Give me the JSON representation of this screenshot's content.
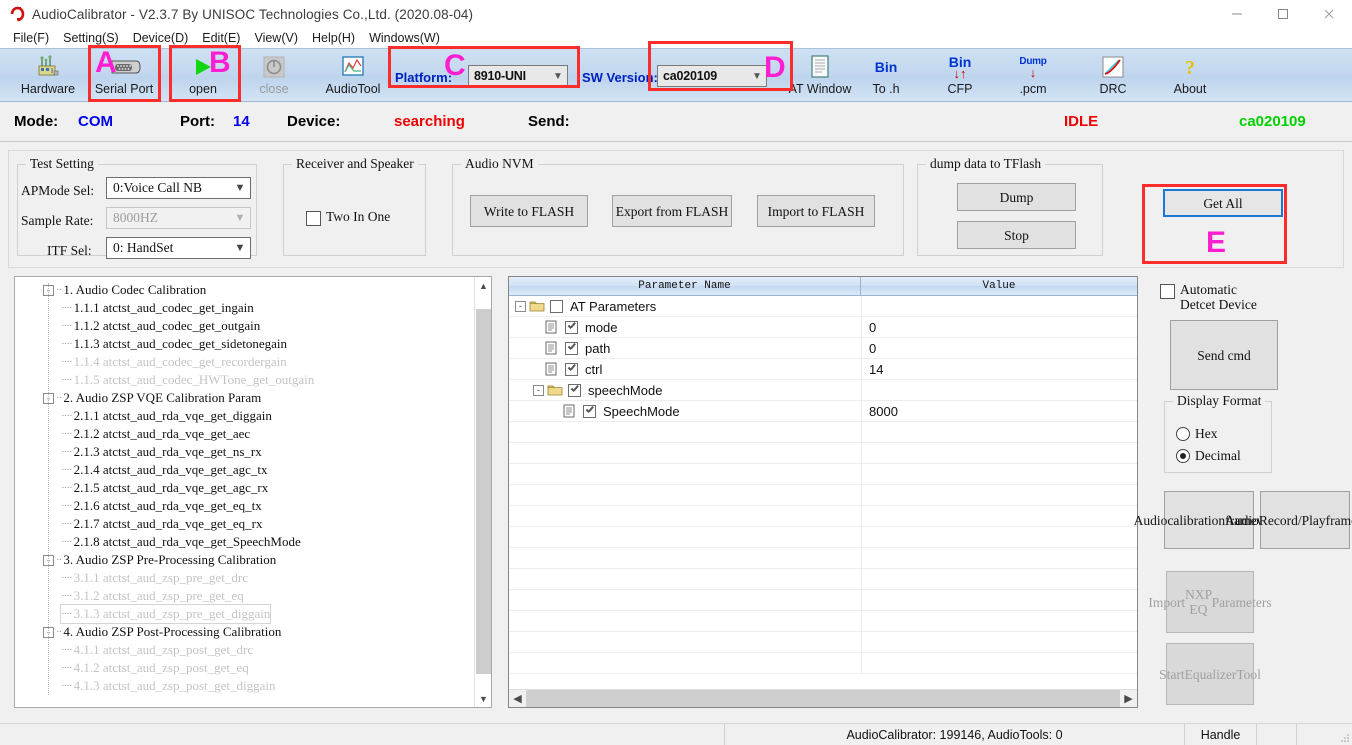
{
  "window": {
    "title": "AudioCalibrator - V2.3.7 By UNISOC Technologies Co.,Ltd. (2020.08-04)",
    "minimize_label": "—",
    "maximize_label": "□",
    "close_label": "✕"
  },
  "menu": [
    {
      "label": "File(F)"
    },
    {
      "label": "Setting(S)"
    },
    {
      "label": "Device(D)"
    },
    {
      "label": "Edit(E)"
    },
    {
      "label": "View(V)"
    },
    {
      "label": "Help(H)"
    },
    {
      "label": "Windows(W)"
    }
  ],
  "toolbar": {
    "buttons": [
      {
        "label": "Hardware",
        "icon": "hardware-icon",
        "disabled": false
      },
      {
        "label": "Serial Port",
        "icon": "serial-port-icon",
        "disabled": false
      },
      {
        "label": "open",
        "icon": "play-icon",
        "disabled": false
      },
      {
        "label": "close",
        "icon": "stop-power-icon",
        "disabled": true
      },
      {
        "label": "AudioTool",
        "icon": "audiotool-icon",
        "disabled": false
      },
      {
        "label": "AT Window",
        "icon": "document-icon",
        "disabled": false
      },
      {
        "label": "To .h",
        "icon": "bin-icon",
        "disabled": false
      },
      {
        "label": "CFP",
        "icon": "bin-transfer-icon",
        "disabled": false
      },
      {
        "label": ".pcm",
        "icon": "dump-down-icon",
        "disabled": false
      },
      {
        "label": "DRC",
        "icon": "drc-curve-icon",
        "disabled": false
      },
      {
        "label": "About",
        "icon": "question-icon",
        "disabled": false
      }
    ],
    "platform_label": "Platform:",
    "platform_value": "8910-UNI",
    "swversion_label": "SW Version:",
    "swversion_value": "ca020109"
  },
  "annotations": [
    {
      "letter": "A",
      "target": "serial-port-button"
    },
    {
      "letter": "B",
      "target": "open-button"
    },
    {
      "letter": "C",
      "target": "platform-combo"
    },
    {
      "letter": "D",
      "target": "swversion-combo"
    },
    {
      "letter": "E",
      "target": "get-all-button"
    }
  ],
  "status_strip": {
    "mode_label": "Mode:",
    "mode_value": "COM",
    "port_label": "Port:",
    "port_value": "14",
    "device_label": "Device:",
    "device_value": "searching",
    "send_label": "Send:",
    "send_value": "",
    "state": "IDLE",
    "version": "ca020109",
    "colors": {
      "mode": "#0000ee",
      "device": "#ee0000",
      "state": "#ee0000",
      "version": "#00d000"
    }
  },
  "test_setting": {
    "title": "Test Setting",
    "apmode_label": "APMode Sel:",
    "apmode_value": "0:Voice Call NB",
    "sample_rate_label": "Sample Rate:",
    "sample_rate_value": "8000HZ",
    "itf_label": "ITF Sel:",
    "itf_value": "0: HandSet"
  },
  "receiver_speaker": {
    "title": "Receiver and Speaker",
    "two_in_one_label": "Two In One",
    "two_in_one_checked": false
  },
  "audio_nvm": {
    "title": "Audio NVM",
    "buttons": [
      "Write to FLASH",
      "Export from FLASH",
      "Import to FLASH"
    ]
  },
  "dump_tflash": {
    "title": "dump data to TFlash",
    "buttons": [
      "Dump",
      "Stop"
    ]
  },
  "get_all": {
    "label": "Get All"
  },
  "tree": {
    "nodes": [
      {
        "text": "1. Audio Codec Calibration",
        "level": 0,
        "expander": "-",
        "dim": false
      },
      {
        "text": "1.1.1 atctst_aud_codec_get_ingain",
        "level": 1,
        "expander": "",
        "dim": false
      },
      {
        "text": "1.1.2 atctst_aud_codec_get_outgain",
        "level": 1,
        "expander": "",
        "dim": false
      },
      {
        "text": "1.1.3 atctst_aud_codec_get_sidetonegain",
        "level": 1,
        "expander": "",
        "dim": false
      },
      {
        "text": "1.1.4 atctst_aud_codec_get_recordergain",
        "level": 1,
        "expander": "",
        "dim": true
      },
      {
        "text": "1.1.5 atctst_aud_codec_HWTone_get_outgain",
        "level": 1,
        "expander": "",
        "dim": true
      },
      {
        "text": "2. Audio ZSP VQE Calibration Param",
        "level": 0,
        "expander": "-",
        "dim": false
      },
      {
        "text": "2.1.1 atctst_aud_rda_vqe_get_diggain",
        "level": 1,
        "expander": "",
        "dim": false
      },
      {
        "text": "2.1.2 atctst_aud_rda_vqe_get_aec",
        "level": 1,
        "expander": "",
        "dim": false
      },
      {
        "text": "2.1.3 atctst_aud_rda_vqe_get_ns_rx",
        "level": 1,
        "expander": "",
        "dim": false
      },
      {
        "text": "2.1.4 atctst_aud_rda_vqe_get_agc_tx",
        "level": 1,
        "expander": "",
        "dim": false
      },
      {
        "text": "2.1.5 atctst_aud_rda_vqe_get_agc_rx",
        "level": 1,
        "expander": "",
        "dim": false
      },
      {
        "text": "2.1.6 atctst_aud_rda_vqe_get_eq_tx",
        "level": 1,
        "expander": "",
        "dim": false
      },
      {
        "text": "2.1.7 atctst_aud_rda_vqe_get_eq_rx",
        "level": 1,
        "expander": "",
        "dim": false
      },
      {
        "text": "2.1.8 atctst_aud_rda_vqe_get_SpeechMode",
        "level": 1,
        "expander": "",
        "dim": false
      },
      {
        "text": "3. Audio ZSP Pre-Processing Calibration",
        "level": 0,
        "expander": "-",
        "dim": false
      },
      {
        "text": "3.1.1 atctst_aud_zsp_pre_get_drc",
        "level": 1,
        "expander": "",
        "dim": true
      },
      {
        "text": "3.1.2 atctst_aud_zsp_pre_get_eq",
        "level": 1,
        "expander": "",
        "dim": true
      },
      {
        "text": "3.1.3 atctst_aud_zsp_pre_get_diggain",
        "level": 1,
        "expander": "",
        "dim": true,
        "focused": true
      },
      {
        "text": "4. Audio ZSP Post-Processing Calibration",
        "level": 0,
        "expander": "-",
        "dim": false
      },
      {
        "text": "4.1.1 atctst_aud_zsp_post_get_drc",
        "level": 1,
        "expander": "",
        "dim": true
      },
      {
        "text": "4.1.2 atctst_aud_zsp_post_get_eq",
        "level": 1,
        "expander": "",
        "dim": true
      },
      {
        "text": "4.1.3 atctst_aud_zsp_post_get_diggain",
        "level": 1,
        "expander": "",
        "dim": true
      }
    ]
  },
  "grid": {
    "columns": [
      "Parameter Name",
      "Value"
    ],
    "rows": [
      {
        "name": "AT Parameters",
        "value": "",
        "level": 0,
        "expander": "-",
        "icon": "folder-icon",
        "checkbox": false
      },
      {
        "name": "mode",
        "value": "0",
        "level": 1,
        "expander": "",
        "icon": "page-icon",
        "checkbox": true
      },
      {
        "name": "path",
        "value": "0",
        "level": 1,
        "expander": "",
        "icon": "page-icon",
        "checkbox": true
      },
      {
        "name": "ctrl",
        "value": "14",
        "level": 1,
        "expander": "",
        "icon": "page-icon",
        "checkbox": true
      },
      {
        "name": "speechMode",
        "value": "",
        "level": 1,
        "expander": "-",
        "icon": "folder-icon",
        "checkbox": true
      },
      {
        "name": "SpeechMode",
        "value": "8000",
        "level": 2,
        "expander": "",
        "icon": "page-icon",
        "checkbox": true
      }
    ]
  },
  "right_rail": {
    "auto_detect_label": "Automatic Detcet Device",
    "auto_detect_checked": false,
    "send_cmd_label": "Send cmd",
    "display_format": {
      "title": "Display Format",
      "options": [
        {
          "label": "Hex",
          "selected": false
        },
        {
          "label": "Decimal",
          "selected": true
        }
      ]
    },
    "buttons": [
      {
        "label": "Audio\ncalibration\nframework",
        "disabled": false
      },
      {
        "label": "Audio\nRecord/Play\nframework",
        "disabled": false
      },
      {
        "label": "Import\nNXP EQ\nParameters",
        "disabled": true
      },
      {
        "label": "Start\nEqualizer\nTool",
        "disabled": true
      }
    ]
  },
  "bottom_bar": {
    "counts": "AudioCalibrator: 199146, AudioTools: 0",
    "handle": "Handle"
  }
}
